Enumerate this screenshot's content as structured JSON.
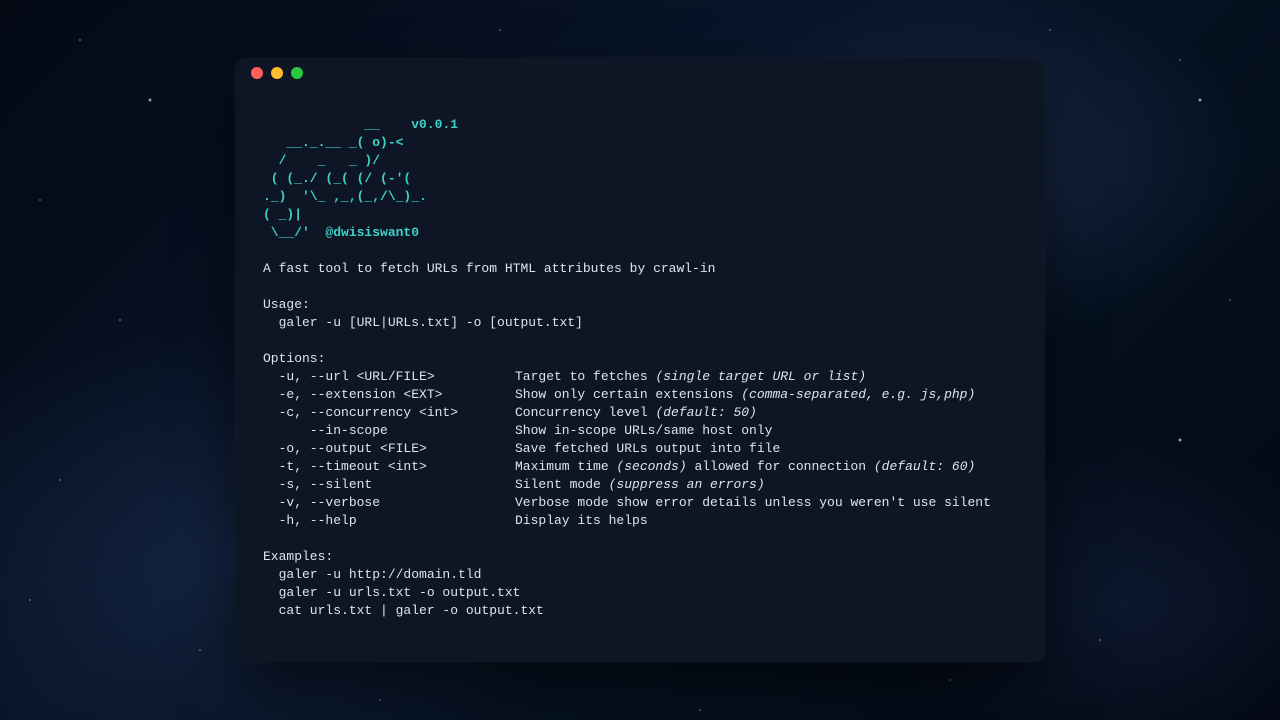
{
  "window": {
    "controls": [
      "close",
      "minimize",
      "zoom"
    ]
  },
  "version": "v0.0.1",
  "author_handle": "@dwisiswant0",
  "ascii": {
    "l1": "             __    ",
    "l2": "   __._.__ _( o)-< ",
    "l3": "  /    _   _ )/    ",
    "l4": " ( (_./ (_( (/ (-'(",
    "l5": "._)  '\\_ ,_,(_,/\\_)_.",
    "l6": "( _)|  ",
    "l7": " \\__/'  "
  },
  "description": "A fast tool to fetch URLs from HTML attributes by crawl-in",
  "usage_header": "Usage:",
  "usage_line": "  galer -u [URL|URLs.txt] -o [output.txt]",
  "options_header": "Options:",
  "options": {
    "u": {
      "flag": "  -u, --url <URL/FILE>",
      "desc": "Target to fetches ",
      "ital": "(single target URL or list)"
    },
    "e": {
      "flag": "  -e, --extension <EXT>",
      "desc": "Show only certain extensions ",
      "ital": "(comma-separated, e.g. js,php)"
    },
    "c": {
      "flag": "  -c, --concurrency <int>",
      "desc": "Concurrency level ",
      "ital": "(default: 50)"
    },
    "in": {
      "flag": "      --in-scope",
      "desc": "Show in-scope URLs/same host only",
      "ital": ""
    },
    "o": {
      "flag": "  -o, --output <FILE>",
      "desc": "Save fetched URLs output into file",
      "ital": ""
    },
    "t": {
      "flag": "  -t, --timeout <int>",
      "desc": "Maximum time ",
      "ital": "(seconds)",
      "desc2": " allowed for connection ",
      "ital2": "(default: 60)"
    },
    "s": {
      "flag": "  -s, --silent",
      "desc": "Silent mode ",
      "ital": "(suppress an errors)"
    },
    "v": {
      "flag": "  -v, --verbose",
      "desc": "Verbose mode show error details unless you weren't use silent",
      "ital": ""
    },
    "h": {
      "flag": "  -h, --help",
      "desc": "Display its helps",
      "ital": ""
    }
  },
  "examples_header": "Examples:",
  "examples": {
    "e1": "  galer -u http://domain.tld",
    "e2": "  galer -u urls.txt -o output.txt",
    "e3": "  cat urls.txt | galer -o output.txt"
  }
}
